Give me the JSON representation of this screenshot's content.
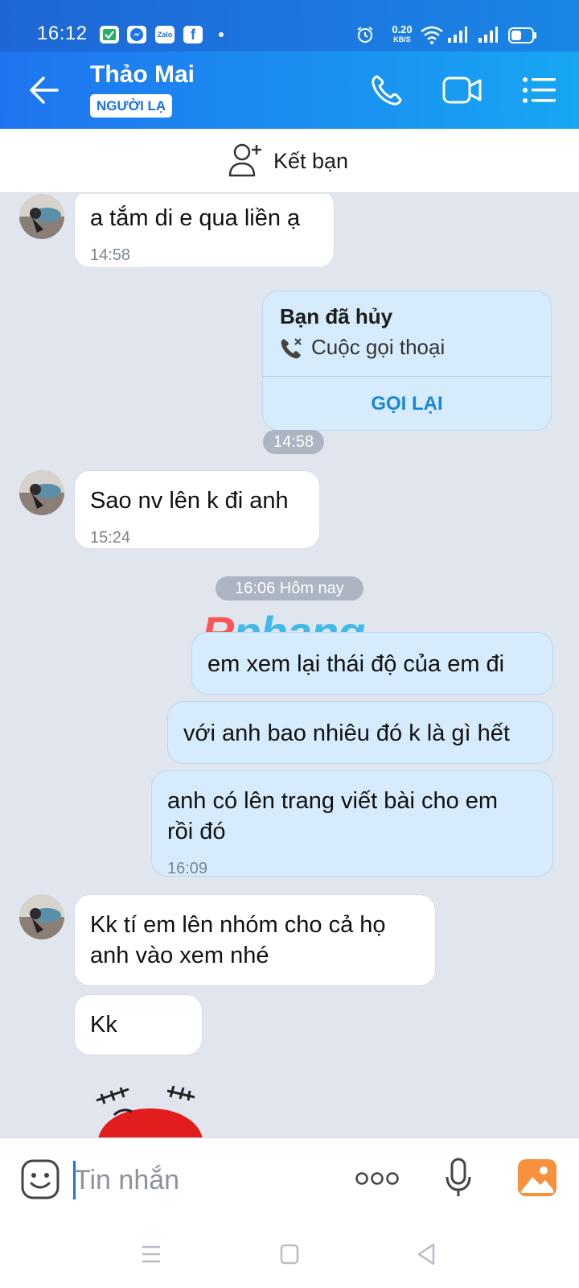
{
  "status_bar": {
    "time": "16:12",
    "notification_icons": [
      "check-app-icon",
      "messenger-icon",
      "zalo-icon",
      "facebook-icon"
    ],
    "zalo_label": "Zalo",
    "net_speed": "0.20",
    "net_speed_unit": "KB/S",
    "indicators": [
      "alarm-icon",
      "wifi-icon",
      "signal-icon",
      "signal-icon",
      "battery-icon"
    ]
  },
  "header": {
    "contact_name": "Thảo Mai",
    "badge": "NGƯỜI LẠ",
    "actions": [
      "back-icon",
      "phone-icon",
      "video-call-icon",
      "menu-icon"
    ]
  },
  "friend_bar": {
    "label": "Kết bạn",
    "icon": "add-friend-icon"
  },
  "messages": [
    {
      "side": "in",
      "text": "a tắm di e qua liền ạ",
      "time": "14:58"
    },
    {
      "side": "out",
      "type": "call",
      "title": "Bạn đã hủy",
      "subtitle": "Cuộc gọi thoại",
      "action": "GỌI LẠI"
    },
    {
      "type": "time_pill",
      "text": "14:58"
    },
    {
      "side": "in",
      "text": "Sao nv lên k đi anh",
      "time": "15:24"
    },
    {
      "type": "time_pill",
      "text": "16:06 Hôm nay"
    },
    {
      "side": "out",
      "text": "em xem lại thái độ của em đi"
    },
    {
      "side": "out",
      "text": "với anh bao nhiêu đó k là gì hết"
    },
    {
      "side": "out",
      "lines": [
        "anh có lên trang viết bài cho em",
        "rồi đó"
      ],
      "time": "16:09"
    },
    {
      "side": "in",
      "lines": [
        "Kk tí em lên nhóm cho cả họ",
        "anh vào xem nhé"
      ]
    },
    {
      "side": "in",
      "text": "Kk"
    }
  ],
  "watermark": {
    "first": "R",
    "rest": "phang"
  },
  "input_bar": {
    "placeholder": "Tin nhắn",
    "icons": [
      "emoji-icon",
      "more-icon",
      "microphone-icon",
      "image-icon"
    ]
  },
  "nav_bar": {
    "buttons": [
      "recent-apps-icon",
      "home-icon",
      "back-nav-icon"
    ]
  },
  "colors": {
    "header_start": "#1f75f0",
    "header_end": "#17a6f2",
    "chat_bg": "#e1e6ee",
    "outgoing_bubble": "#d6ecfc",
    "incoming_bubble": "#ffffff",
    "accent": "#1a86d8"
  }
}
